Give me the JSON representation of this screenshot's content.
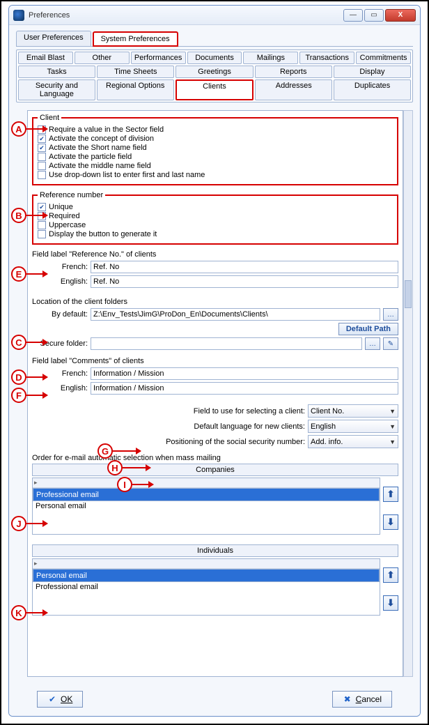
{
  "window": {
    "title": "Preferences"
  },
  "main_tabs": {
    "user": "User Preferences",
    "system": "System Preferences"
  },
  "subtabs": {
    "row1": [
      "Email Blast",
      "Other",
      "Performances",
      "Documents",
      "Mailings",
      "Transactions",
      "Commitments"
    ],
    "row2": [
      "Tasks",
      "Time Sheets",
      "Greetings",
      "Reports",
      "Display"
    ],
    "row3": [
      "Security and Language",
      "Regional Options",
      "Clients",
      "Addresses",
      "Duplicates"
    ]
  },
  "client_group": {
    "legend": "Client",
    "items": [
      {
        "label": "Require a value in the Sector field",
        "checked": false
      },
      {
        "label": "Activate the concept of division",
        "checked": true
      },
      {
        "label": "Activate the Short name field",
        "checked": true
      },
      {
        "label": "Activate the particle field",
        "checked": false
      },
      {
        "label": "Activate the middle name field",
        "checked": false
      },
      {
        "label": "Use drop-down list to enter first and last name",
        "checked": false
      }
    ]
  },
  "refnum_group": {
    "legend": "Reference number",
    "items": [
      {
        "label": "Unique",
        "checked": true
      },
      {
        "label": "Required",
        "checked": false
      },
      {
        "label": "Uppercase",
        "checked": false
      },
      {
        "label": "Display the button to generate it",
        "checked": false
      }
    ]
  },
  "refno_labels": {
    "heading": "Field label \"Reference No.\" of clients",
    "french_lbl": "French:",
    "french_val": "Ref. No",
    "english_lbl": "English:",
    "english_val": "Ref. No"
  },
  "folders": {
    "heading": "Location of the client folders",
    "bydefault_lbl": "By default:",
    "bydefault_val": "Z:\\Env_Tests\\JimG\\ProDon_En\\Documents\\Clients\\",
    "default_path_btn": "Default Path",
    "secure_lbl": "Secure folder:",
    "secure_val": ""
  },
  "comments_labels": {
    "heading": "Field label \"Comments\" of clients",
    "french_lbl": "French:",
    "french_val": "Information / Mission",
    "english_lbl": "English:",
    "english_val": "Information / Mission"
  },
  "selects": {
    "field_select_lbl": "Field to use for selecting a client:",
    "field_select_val": "Client No.",
    "lang_lbl": "Default language for new clients:",
    "lang_val": "English",
    "ssn_lbl": "Positioning of the social security number:",
    "ssn_val": "Add. info."
  },
  "mail_order": {
    "heading": "Order for e-mail automatic selection when mass mailing",
    "companies_title": "Companies",
    "companies_items": [
      "Professional email",
      "Personal email"
    ],
    "individuals_title": "Individuals",
    "individuals_items": [
      "Personal email",
      "Professional email"
    ]
  },
  "buttons": {
    "ok": "OK",
    "cancel": "Cancel"
  },
  "callouts": {
    "A": "A",
    "B": "B",
    "C": "C",
    "D": "D",
    "E": "E",
    "F": "F",
    "G": "G",
    "H": "H",
    "I": "I",
    "J": "J",
    "K": "K"
  }
}
